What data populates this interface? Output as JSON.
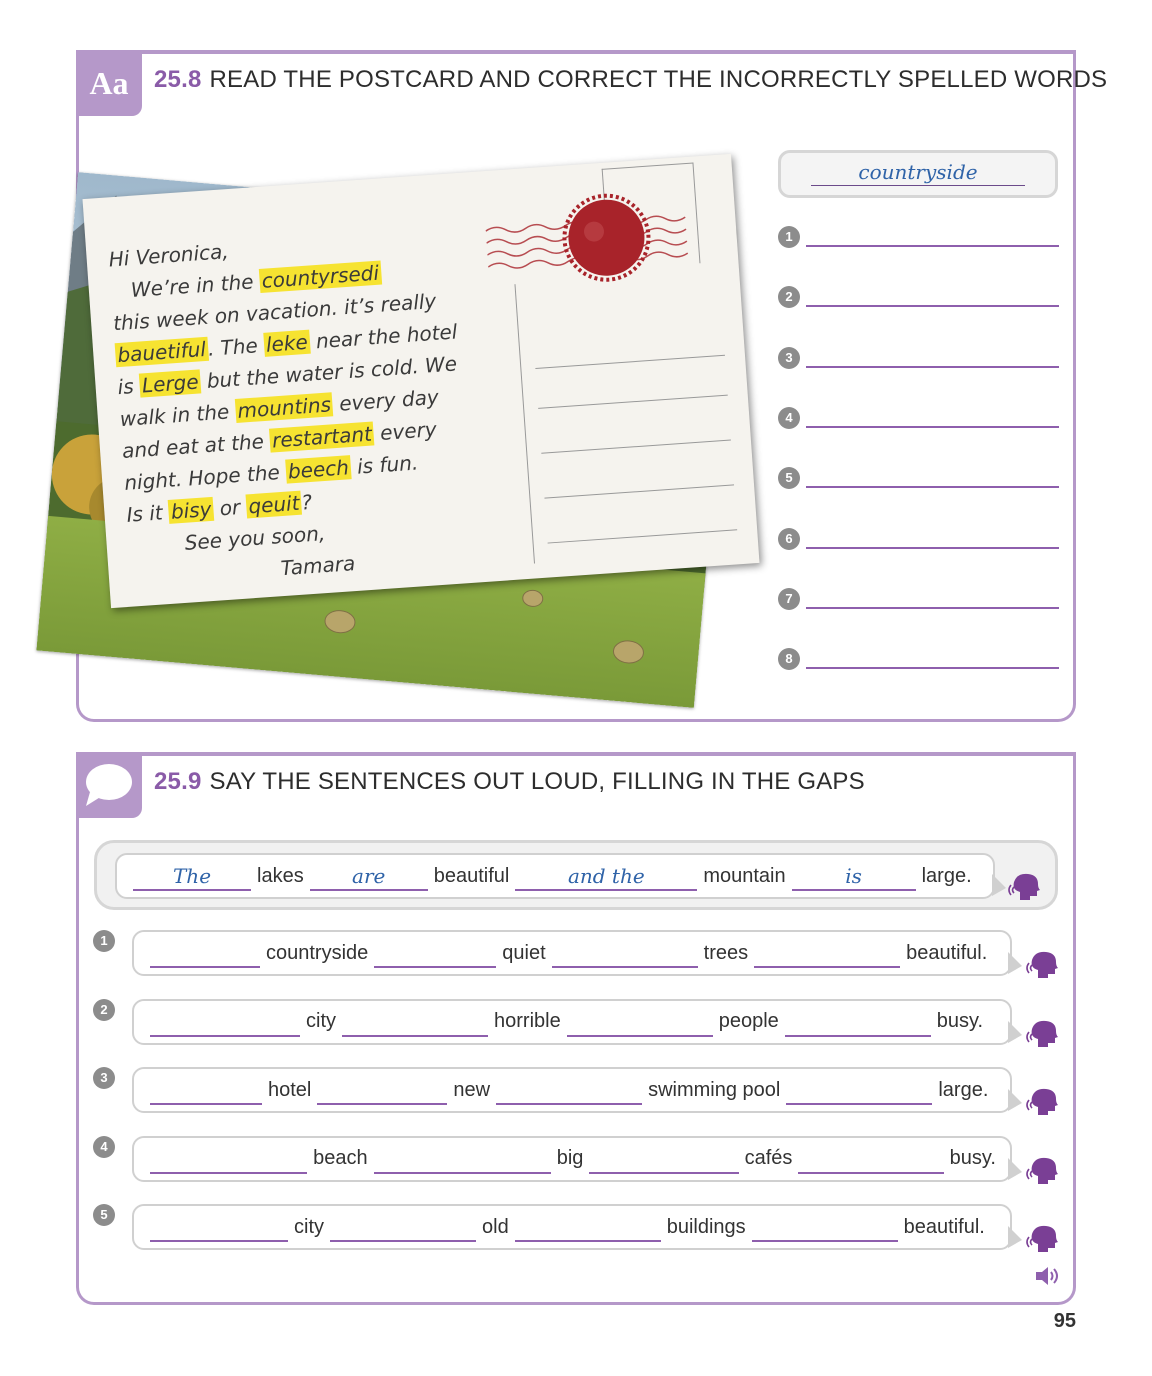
{
  "exercise1": {
    "number": "25.8",
    "title": "READ THE POSTCARD AND CORRECT THE INCORRECTLY SPELLED WORDS",
    "badge_label": "Aa",
    "postcard": {
      "greeting": "Hi Veronica,",
      "lines": [
        [
          "We’re in the ",
          {
            "hl": "countyrsedi"
          }
        ],
        [
          "this week on vacation. it’s really"
        ],
        [
          {
            "hl": "bauetiful"
          },
          ". The ",
          {
            "hl": "leke"
          },
          " near the hotel"
        ],
        [
          "is ",
          {
            "hl": "Lerge"
          },
          " but the water is cold. We"
        ],
        [
          "walk in the ",
          {
            "hl": "mountins"
          },
          " every day"
        ],
        [
          "and eat at the ",
          {
            "hl": "restartant"
          },
          " every"
        ],
        [
          "night. Hope the ",
          {
            "hl": "beech"
          },
          " is fun."
        ],
        [
          "Is it ",
          {
            "hl": "bisy"
          },
          " or ",
          {
            "hl": "qeuit"
          },
          "?"
        ]
      ],
      "signoff": "See you soon,",
      "signature": "Tamara"
    },
    "example_answer": "countryside",
    "answer_numbers": [
      "1",
      "2",
      "3",
      "4",
      "5",
      "6",
      "7",
      "8"
    ]
  },
  "exercise2": {
    "number": "25.9",
    "title": "SAY THE SENTENCES OUT LOUD, FILLING IN THE GAPS",
    "example": {
      "parts": [
        {
          "gap": "The"
        },
        {
          "word": "lakes"
        },
        {
          "gap": "are"
        },
        {
          "word": "beautiful"
        },
        {
          "gap": "and the"
        },
        {
          "word": "mountain"
        },
        {
          "gap": "is"
        },
        {
          "word": "large."
        }
      ]
    },
    "rows": [
      {
        "num": "1",
        "words": [
          "countryside",
          "quiet",
          "trees",
          "beautiful."
        ]
      },
      {
        "num": "2",
        "words": [
          "city",
          "horrible",
          "people",
          "busy."
        ]
      },
      {
        "num": "3",
        "words": [
          "hotel",
          "new",
          "swimming pool",
          "large."
        ]
      },
      {
        "num": "4",
        "words": [
          "beach",
          "big",
          "cafés",
          "busy."
        ]
      },
      {
        "num": "5",
        "words": [
          "city",
          "old",
          "buildings",
          "beautiful."
        ]
      }
    ]
  },
  "page_number": "95",
  "colors": {
    "accent": "#b598c9",
    "heading_number": "#8a5ba8",
    "highlight": "#f6e331",
    "handwriting": "#2f63a8",
    "answer_line": "#8e5fad"
  },
  "icons": [
    "aa-badge-icon",
    "speech-bubble-icon",
    "postmark-stamp-icon",
    "speaking-head-icon",
    "speaker-icon"
  ]
}
